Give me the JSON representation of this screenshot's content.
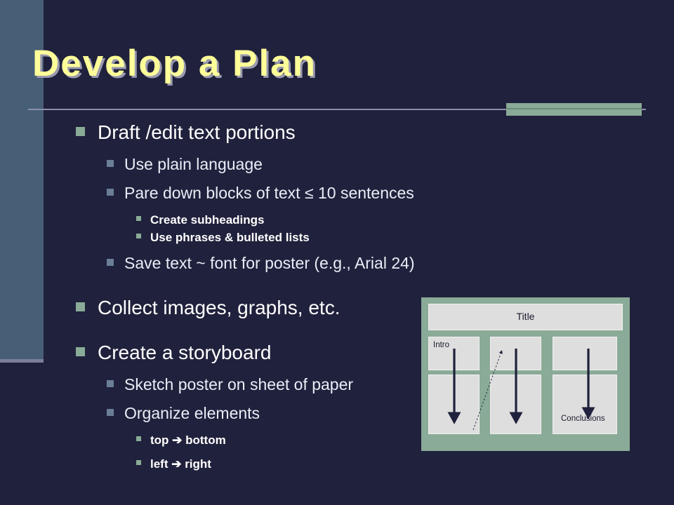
{
  "slide": {
    "title": "Develop a Plan",
    "title_color": "#ffff99",
    "background_color": "#20213c",
    "sidebar_color": "#475e77",
    "accent_color": "#8aab97"
  },
  "outline": [
    {
      "level": 1,
      "text": "Draft /edit text portions"
    },
    {
      "level": 2,
      "text": "Use plain language"
    },
    {
      "level": 2,
      "text": "Pare down blocks of text ≤ 10 sentences"
    },
    {
      "level": 3,
      "text": "Create subheadings"
    },
    {
      "level": 3,
      "text": "Use phrases & bulleted lists"
    },
    {
      "level": 2,
      "text": "Save text ~ font for poster (e.g., Arial 24)"
    },
    {
      "level": 1,
      "text": "Collect images, graphs, etc."
    },
    {
      "level": 1,
      "text": "Create a storyboard"
    },
    {
      "level": 2,
      "text": "Sketch poster on sheet of paper"
    },
    {
      "level": 2,
      "text": "Organize elements"
    },
    {
      "level": 3,
      "text": "top ➔ bottom"
    },
    {
      "level": 3,
      "text": "left ➔ right"
    }
  ],
  "storyboard": {
    "title_box_label": "Title",
    "intro_label": "Intro",
    "conclusions_label": "Conclusions",
    "frame_color": "#8aab97",
    "box_color": "#dedede",
    "arrow_color": "#20213c"
  }
}
